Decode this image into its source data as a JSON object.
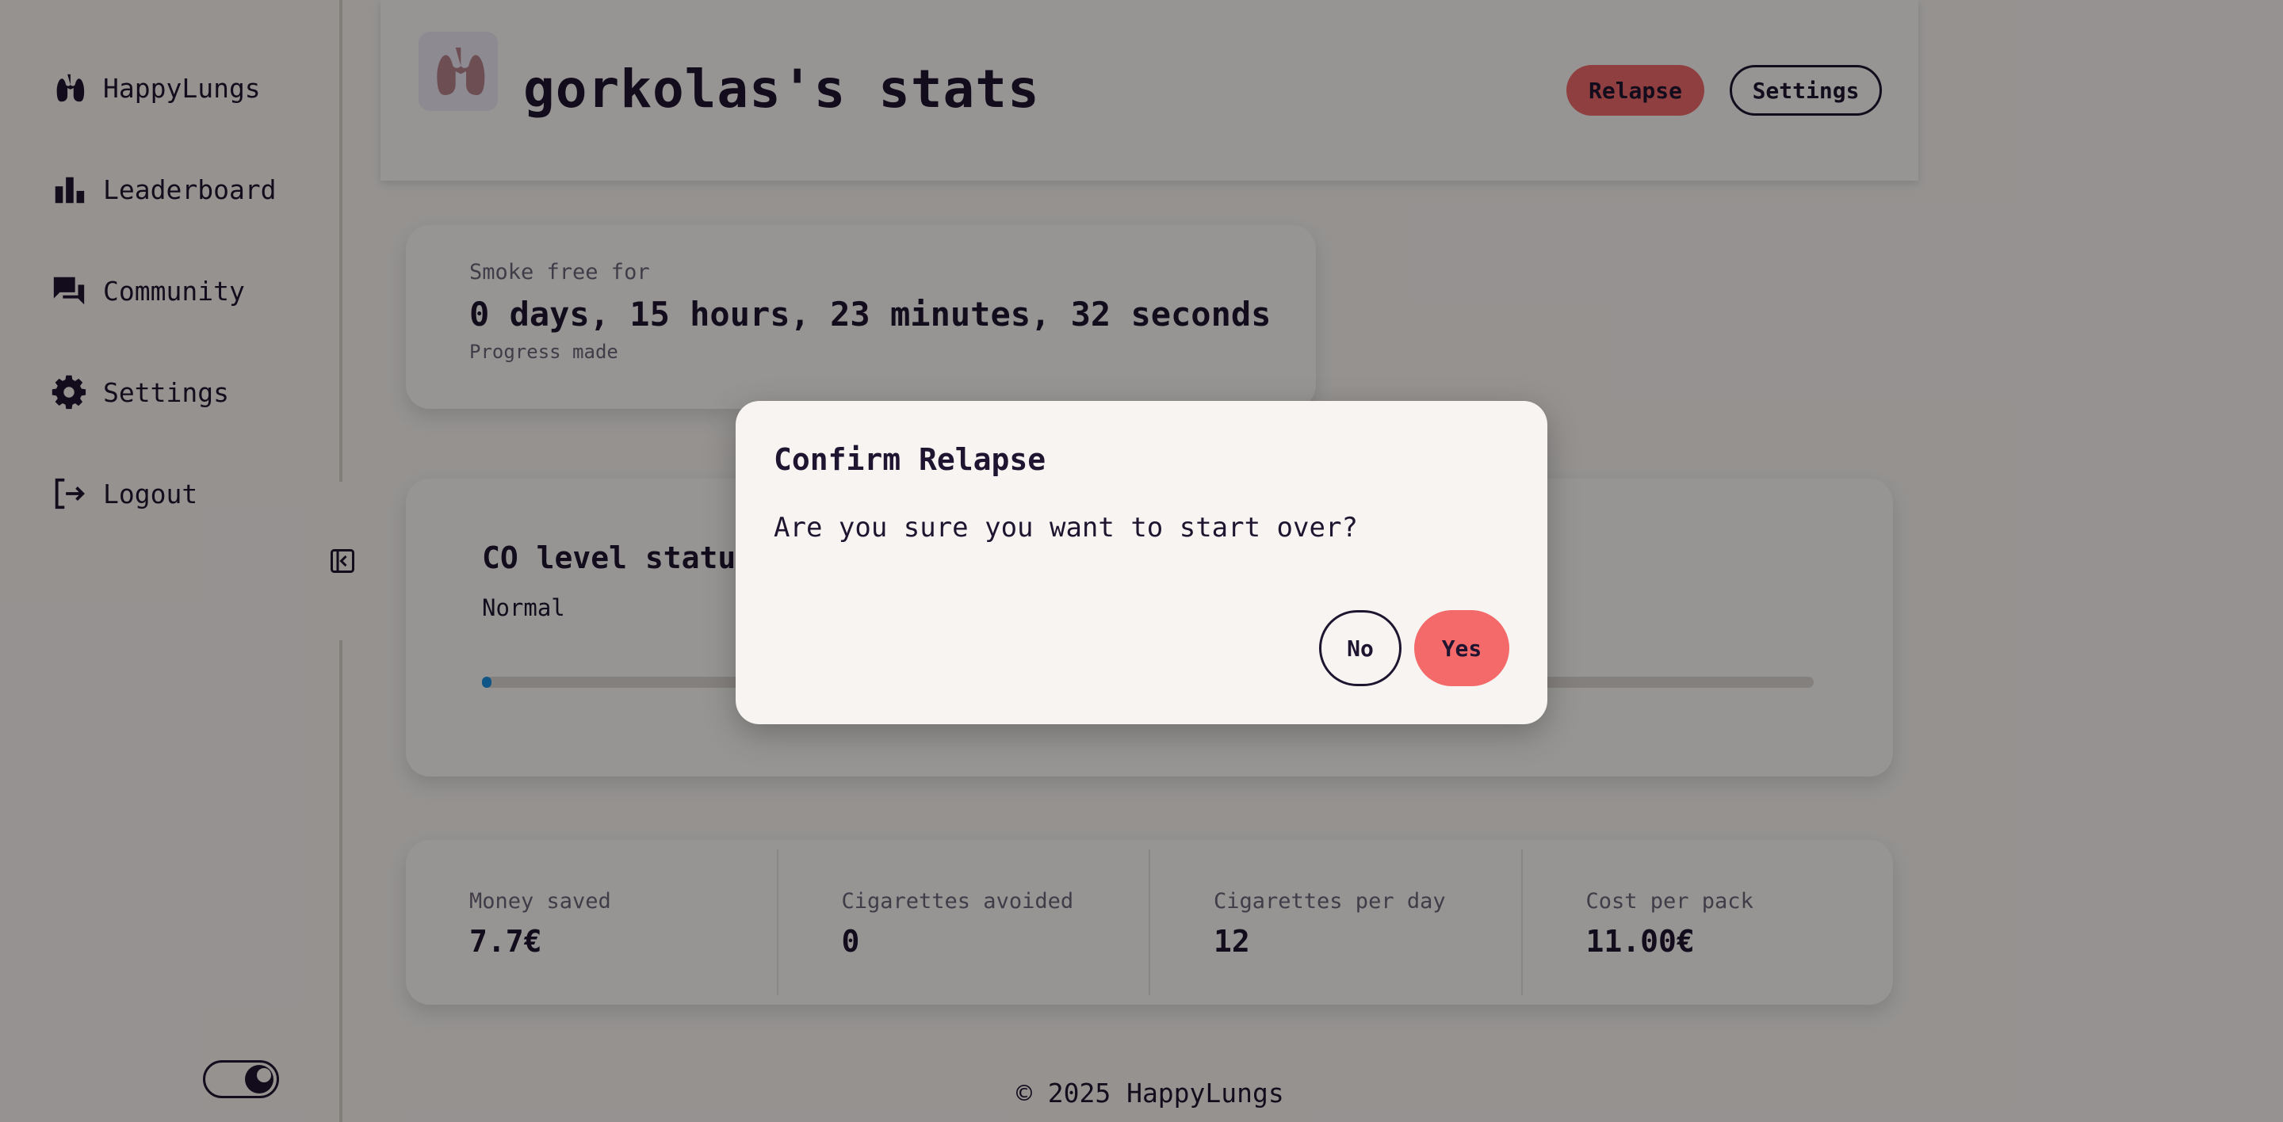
{
  "sidebar": {
    "items": [
      {
        "label": "HappyLungs",
        "icon": "lungs-icon"
      },
      {
        "label": "Leaderboard",
        "icon": "bar-chart-icon"
      },
      {
        "label": "Community",
        "icon": "chat-icon"
      },
      {
        "label": "Settings",
        "icon": "gear-icon"
      },
      {
        "label": "Logout",
        "icon": "logout-icon"
      }
    ]
  },
  "header": {
    "title": "gorkolas's stats",
    "relapse_label": "Relapse",
    "settings_label": "Settings"
  },
  "smoke_free": {
    "label": "Smoke free for",
    "duration": "0 days, 15 hours, 23 minutes, 32 seconds",
    "progress_label": "Progress made"
  },
  "co_level": {
    "title": "CO level status",
    "status": "Normal",
    "progress_fraction": 0.004
  },
  "stats": [
    {
      "label": "Money saved",
      "value": "7.7€"
    },
    {
      "label": "Cigarettes avoided",
      "value": "0"
    },
    {
      "label": "Cigarettes per day",
      "value": "12"
    },
    {
      "label": "Cost per pack",
      "value": "11.00€"
    }
  ],
  "footer": {
    "text": "© 2025 HappyLungs"
  },
  "dialog": {
    "title": "Confirm Relapse",
    "message": "Are you sure you want to start over?",
    "no_label": "No",
    "yes_label": "Yes"
  },
  "colors": {
    "accent": "#f46a6a",
    "text": "#1f1530",
    "background": "#f8f4f1",
    "progress": "#1a8ee0"
  }
}
